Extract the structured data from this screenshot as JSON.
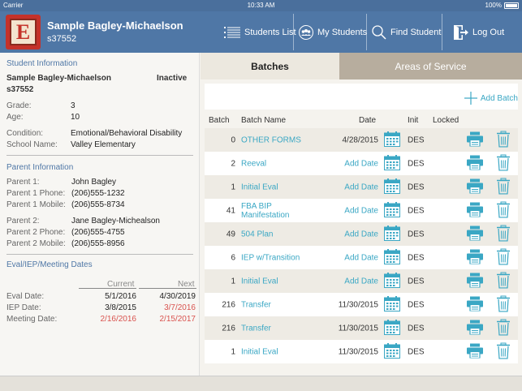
{
  "status": {
    "carrier": "Carrier",
    "time": "10:33 AM",
    "battery": "100%"
  },
  "header": {
    "logo_letter": "E",
    "student_name": "Sample Bagley-Michaelson",
    "student_id": "s37552",
    "nav": [
      {
        "label": "Students List",
        "icon": "list-icon"
      },
      {
        "label": "My Students",
        "icon": "group-icon"
      },
      {
        "label": "Find Student",
        "icon": "search-icon"
      },
      {
        "label": "Log Out",
        "icon": "logout-icon"
      }
    ]
  },
  "student_info": {
    "section_title": "Student Information",
    "name": "Sample Bagley-Michaelson",
    "status": "Inactive",
    "id": "s37552",
    "fields": [
      {
        "label": "Grade:",
        "value": "3"
      },
      {
        "label": "Age:",
        "value": "10"
      },
      {
        "label": "Condition:",
        "value": "Emotional/Behavioral Disability"
      },
      {
        "label": "School Name:",
        "value": "Valley Elementary"
      }
    ]
  },
  "parent_info": {
    "section_title": "Parent Information",
    "fields": [
      {
        "label": "Parent 1:",
        "value": "John Bagley"
      },
      {
        "label": "Parent 1 Phone:",
        "value": "(206)555-1232"
      },
      {
        "label": "Parent 1 Mobile:",
        "value": "(206)555-8734"
      },
      {
        "label": "Parent 2:",
        "value": "Jane Bagley-Michealson"
      },
      {
        "label": "Parent 2 Phone:",
        "value": "(206)555-4755"
      },
      {
        "label": "Parent 2 Mobile:",
        "value": "(206)555-8956"
      }
    ]
  },
  "dates": {
    "section_title": "Eval/IEP/Meeting Dates",
    "col_current": "Current",
    "col_next": "Next",
    "rows": [
      {
        "label": "Eval Date:",
        "current": "5/1/2016",
        "next": "4/30/2019",
        "current_red": false,
        "next_red": false
      },
      {
        "label": "IEP Date:",
        "current": "3/8/2015",
        "next": "3/7/2016",
        "current_red": false,
        "next_red": true
      },
      {
        "label": "Meeting Date:",
        "current": "2/16/2016",
        "next": "2/15/2017",
        "current_red": true,
        "next_red": true
      }
    ]
  },
  "tabs": {
    "active": "Batches",
    "inactive": "Areas of Service"
  },
  "add_batch_label": "Add Batch",
  "table": {
    "headers": {
      "batch": "Batch",
      "name": "Batch Name",
      "date": "Date",
      "init": "Init",
      "locked": "Locked"
    },
    "rows": [
      {
        "batch": "0",
        "name": "OTHER FORMS",
        "date": "4/28/2015",
        "date_set": true,
        "init": "DES"
      },
      {
        "batch": "2",
        "name": "Reeval",
        "date": "Add Date",
        "date_set": false,
        "init": "DES"
      },
      {
        "batch": "1",
        "name": "Initial Eval",
        "date": "Add Date",
        "date_set": false,
        "init": "DES"
      },
      {
        "batch": "41",
        "name": "FBA BIP Manifestation",
        "date": "Add Date",
        "date_set": false,
        "init": "DES"
      },
      {
        "batch": "49",
        "name": "504 Plan",
        "date": "Add Date",
        "date_set": false,
        "init": "DES"
      },
      {
        "batch": "6",
        "name": "IEP w/Transition",
        "date": "Add Date",
        "date_set": false,
        "init": "DES"
      },
      {
        "batch": "1",
        "name": "Initial Eval",
        "date": "Add Date",
        "date_set": false,
        "init": "DES"
      },
      {
        "batch": "216",
        "name": "Transfer",
        "date": "11/30/2015",
        "date_set": true,
        "init": "DES"
      },
      {
        "batch": "216",
        "name": "Transfer",
        "date": "11/30/2015",
        "date_set": true,
        "init": "DES"
      },
      {
        "batch": "1",
        "name": "Initial Eval",
        "date": "11/30/2015",
        "date_set": true,
        "init": "DES"
      }
    ]
  },
  "colors": {
    "nav": "#4f77a6",
    "accent": "#3aa7c4",
    "alert": "#d9534f",
    "tab_inactive": "#b7ad9e"
  }
}
